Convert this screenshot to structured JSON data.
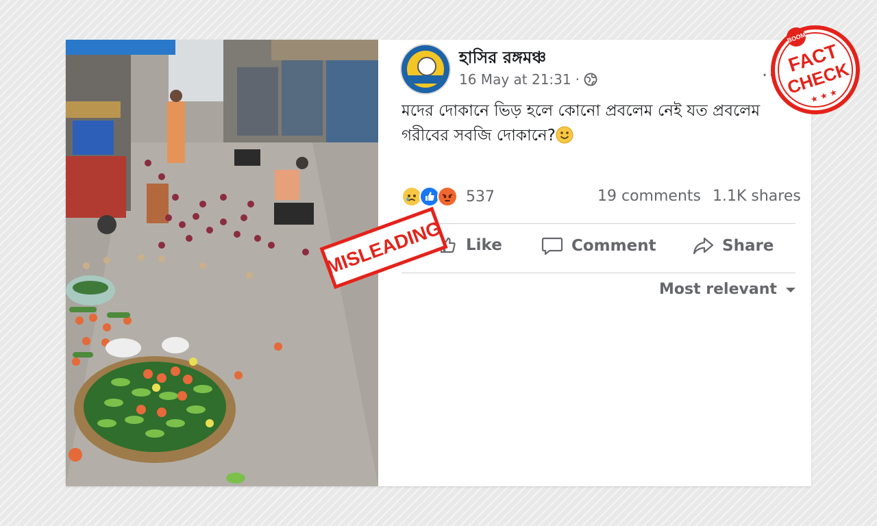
{
  "post": {
    "page_name": "হাসির রঙ্গমঞ্চ",
    "timestamp": "16 May at 21:31",
    "separator": "·",
    "more": "...",
    "text": "মদের দোকানে ভিড় হলে কোনো প্রবলেম নেই যত প্রবলেম গরীবের সবজি দোকানে?",
    "reactions_count": "537",
    "comments": "19 comments",
    "shares": "1.1K shares"
  },
  "actions": {
    "like_label": "Like",
    "comment_label": "Comment",
    "share_label": "Share"
  },
  "sort": {
    "label": "Most relevant"
  },
  "overlays": {
    "misleading_stamp": "MISLEADING",
    "boom": "BOOM",
    "fact": "FACT",
    "check": "CHECK"
  },
  "colors": {
    "stamp_red": "#e3231b",
    "text_primary": "#1c1e21",
    "text_secondary": "#65676b",
    "like_blue": "#1877f2"
  },
  "icons": [
    "globe-icon",
    "smile-icon",
    "sad-icon",
    "like-icon",
    "angry-icon",
    "like-thumb-icon",
    "comment-icon",
    "share-icon",
    "chevron-down-icon"
  ]
}
